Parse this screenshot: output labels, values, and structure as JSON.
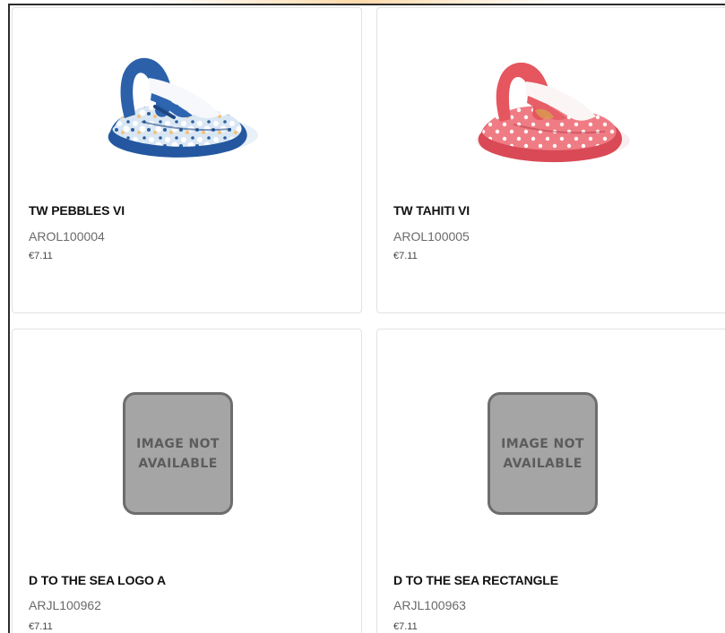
{
  "products": [
    {
      "title": "TW PEBBLES VI",
      "sku": "AROL100004",
      "price": "€7.11",
      "image_alt": "blue floral flip flop sandal",
      "colors": {
        "strap": "#285aa1",
        "sole": "#1f4b8f",
        "footbed": "#d8e3ef",
        "flowers": "#ffffff"
      }
    },
    {
      "title": "TW TAHITI VI",
      "sku": "AROL100005",
      "price": "€7.11",
      "image_alt": "pink polka dot flip flop sandal",
      "colors": {
        "strap": "#e35d61",
        "sole": "#dc4d58",
        "footbed": "#f07f86",
        "dots": "#ffffff"
      }
    },
    {
      "title": "D TO THE SEA LOGO A",
      "sku": "ARJL100962",
      "price": "€7.11",
      "placeholder": {
        "line1": "IMAGE NOT",
        "line2": "AVAILABLE"
      }
    },
    {
      "title": "D TO THE SEA RECTANGLE",
      "sku": "ARJL100963",
      "price": "€7.11",
      "placeholder": {
        "line1": "IMAGE NOT",
        "line2": "AVAILABLE"
      }
    }
  ],
  "colors": {
    "card_border": "#e2e2e2",
    "title_text": "#111111",
    "sku_text": "#6a6a6a",
    "placeholder_fill": "#a5a5a5",
    "placeholder_border": "#6d6d6d"
  }
}
